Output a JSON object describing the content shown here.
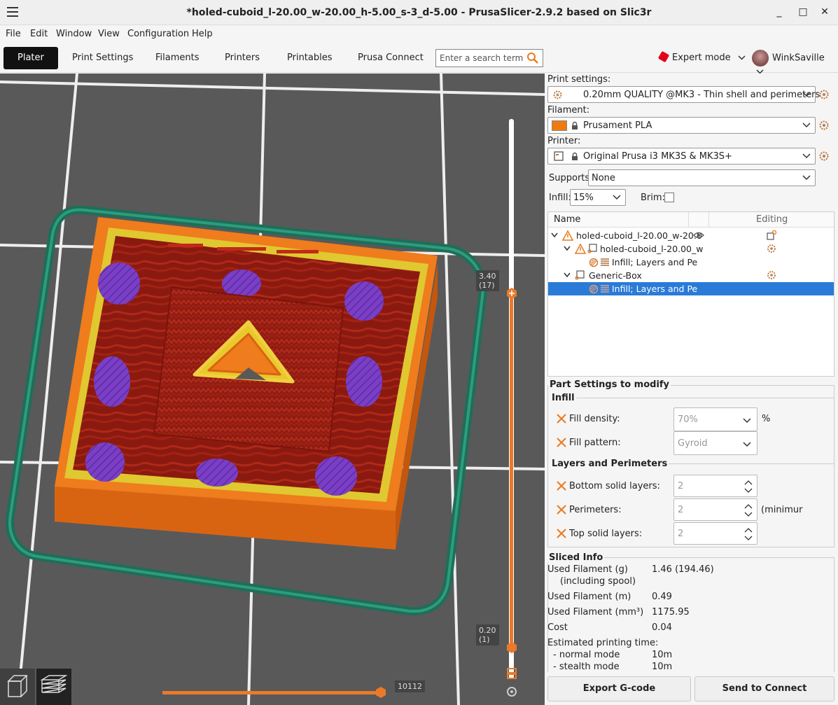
{
  "window": {
    "title": "*holed-cuboid_l-20.00_w-20.00_h-5.00_s-3_d-5.00 - PrusaSlicer-2.9.2 based on Slic3r",
    "minimize": "_",
    "maximize": "□",
    "close": "✕"
  },
  "menu": [
    "File",
    "Edit",
    "Window",
    "View",
    "Configuration",
    "Help"
  ],
  "tabs": [
    "Plater",
    "Print Settings",
    "Filaments",
    "Printers",
    "Printables",
    "Prusa Connect"
  ],
  "search": {
    "placeholder": "Enter a search term"
  },
  "mode": {
    "label": "Expert mode",
    "color": "#e3001b"
  },
  "user": {
    "name": "WinkSaville"
  },
  "settings": {
    "print_label": "Print settings:",
    "print_value": "0.20mm QUALITY @MK3 - Thin shell and perimeters",
    "filament_label": "Filament:",
    "filament_value": "Prusament PLA",
    "filament_color": "#f07a10",
    "printer_label": "Printer:",
    "printer_value": "Original Prusa i3 MK3S & MK3S+",
    "supports_label": "Supports:",
    "supports_value": "None",
    "infill_label": "Infill:",
    "infill_value": "15%",
    "brim_label": "Brim:"
  },
  "object_list": {
    "col_name": "Name",
    "col_editing": "Editing",
    "rows": [
      "holed-cuboid_l-20.00_w-20.0",
      "holed-cuboid_l-20.00_w",
      "Infill; Layers and Pe",
      "Generic-Box",
      "Infill; Layers and Pe"
    ]
  },
  "part_settings": {
    "title": "Part Settings to modify",
    "infill_group": "Infill",
    "fill_density_label": "Fill density:",
    "fill_density_value": "70%",
    "fill_density_unit": "%",
    "fill_pattern_label": "Fill pattern:",
    "fill_pattern_value": "Gyroid",
    "layers_group": "Layers and Perimeters",
    "bottom_label": "Bottom solid layers:",
    "bottom_value": "2",
    "perimeters_label": "Perimeters:",
    "perimeters_value": "2",
    "perimeters_note": "(minimur",
    "top_label": "Top solid layers:",
    "top_value": "2"
  },
  "sliced_info": {
    "title": "Sliced Info",
    "rows": [
      {
        "label": "Used Filament (g)",
        "value": "1.46 (194.46)"
      },
      {
        "label": "(including spool)",
        "value": ""
      },
      {
        "label": "Used Filament (m)",
        "value": "0.49"
      },
      {
        "label": "Used Filament (mm³)",
        "value": "1175.95"
      },
      {
        "label": "Cost",
        "value": "0.04"
      },
      {
        "label": "Estimated printing time:",
        "value": ""
      },
      {
        "label": "- normal mode",
        "value": "10m"
      },
      {
        "label": "- stealth mode",
        "value": "10m"
      }
    ]
  },
  "buttons": {
    "export": "Export G-code",
    "send": "Send to Connect"
  },
  "layer_slider": {
    "top_height": "3.40",
    "top_layer": "(17)",
    "bottom_height": "0.20",
    "bottom_layer": "(1)",
    "horizontal_value": "10112"
  }
}
